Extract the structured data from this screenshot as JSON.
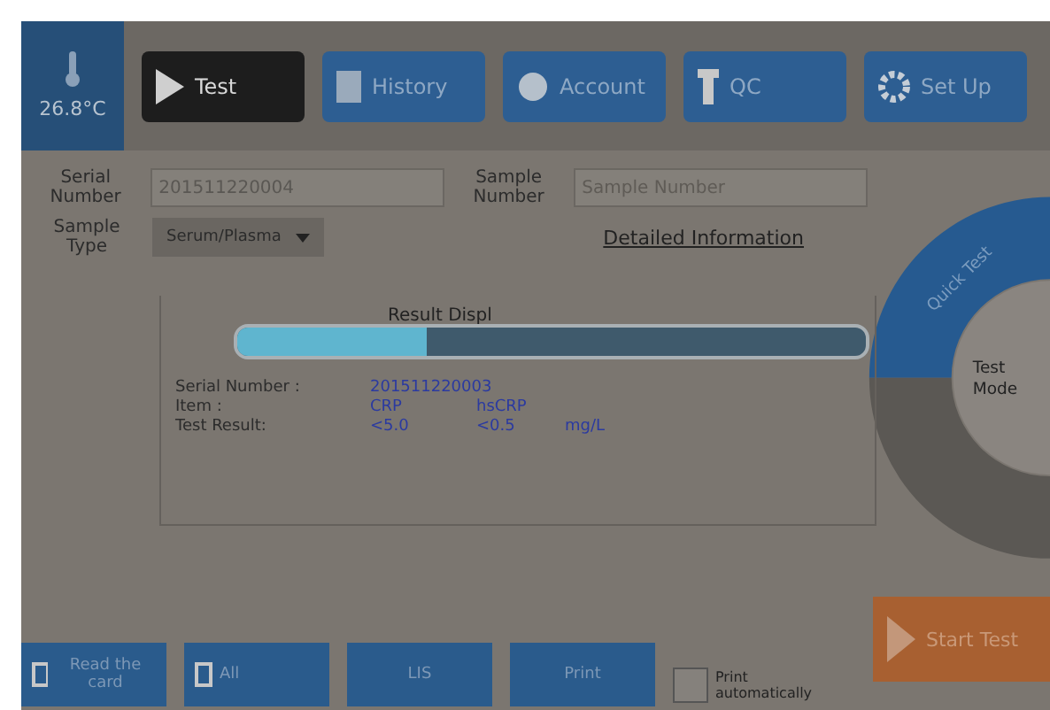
{
  "temperature": "26.8°C",
  "nav": [
    {
      "label": "Test",
      "selected": true
    },
    {
      "label": "History",
      "selected": false
    },
    {
      "label": "Account",
      "selected": false
    },
    {
      "label": "QC",
      "selected": false
    },
    {
      "label": "Set Up",
      "selected": false
    }
  ],
  "form": {
    "serial_label": "Serial Number",
    "serial_value": "201511220004",
    "sample_label": "Sample Number",
    "sample_placeholder": "Sample Number",
    "type_label": "Sample Type",
    "type_value": "Serum/Plasma",
    "details_link": "Detailed Information"
  },
  "progress": {
    "level": 0.3
  },
  "result": {
    "title": "Result Displ",
    "rows": [
      {
        "label": "Serial Number :",
        "values": [
          "201511220003"
        ]
      },
      {
        "label": "Item :",
        "values": [
          "CRP",
          "hsCRP"
        ]
      },
      {
        "label": "Test Result:",
        "values": [
          "<5.0",
          "<0.5",
          "mg/L"
        ]
      }
    ]
  },
  "mode_ring": {
    "arc_label": "Quick Test",
    "center_label": "Test Mode"
  },
  "bottom_buttons": [
    {
      "label": "Read the card",
      "kind": "card"
    },
    {
      "label": "All",
      "kind": "card"
    },
    {
      "label": "LIS",
      "kind": "plain"
    },
    {
      "label": "Print",
      "kind": "plain"
    }
  ],
  "print_auto": {
    "label": "Print automatically",
    "checked": false
  },
  "start_button": "Start Test"
}
